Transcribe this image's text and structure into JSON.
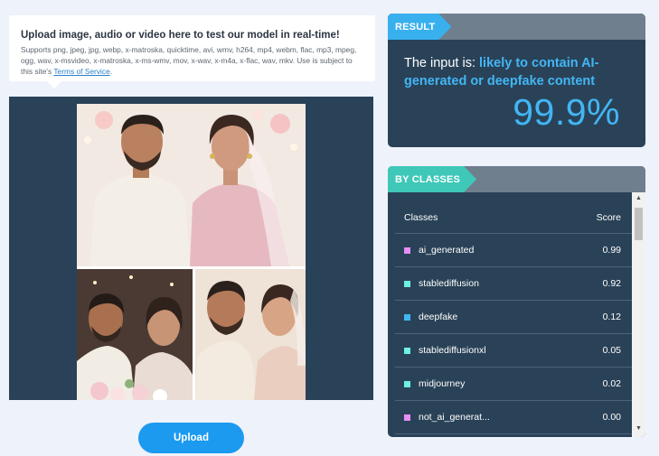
{
  "upload": {
    "title": "Upload image, audio or video here to test our model in real-time!",
    "supported_text": "Supports png, jpeg, jpg, webp, x-matroska, quicktime, avi, wmv, h264, mp4, webm, flac, mp3, mpeg, ogg, wav, x-msvideo, x-matroska, x-ms-wmv, mov, x-wav, x-m4a, x-flac, wav, mkv. Use is subject to this site's ",
    "terms_link": "Terms of Service",
    "terms_suffix": ".",
    "button_label": "Upload"
  },
  "result": {
    "tag": "RESULT",
    "prefix": "The input is: ",
    "verdict": "likely to contain AI-generated or deepfake content",
    "score": "99.9%"
  },
  "classes": {
    "tag": "BY CLASSES",
    "col_class": "Classes",
    "col_score": "Score",
    "rows": [
      {
        "name": "ai_generated",
        "score": "0.99",
        "color": "#e78ef5"
      },
      {
        "name": "stablediffusion",
        "score": "0.92",
        "color": "#6ff0e3"
      },
      {
        "name": "deepfake",
        "score": "0.12",
        "color": "#42b6f5"
      },
      {
        "name": "stablediffusionxl",
        "score": "0.05",
        "color": "#6ff0e3"
      },
      {
        "name": "midjourney",
        "score": "0.02",
        "color": "#6ff0e3"
      },
      {
        "name": "not_ai_generat...",
        "score": "0.00",
        "color": "#e78ef5"
      }
    ]
  },
  "icons": {
    "scroll_up": "triangle-up",
    "scroll_down": "triangle-down"
  },
  "colors": {
    "accent_blue": "#1b9af0",
    "result_tag": "#39b0ee",
    "classes_tag": "#3fc8b8",
    "card_bg": "#2a4257"
  }
}
